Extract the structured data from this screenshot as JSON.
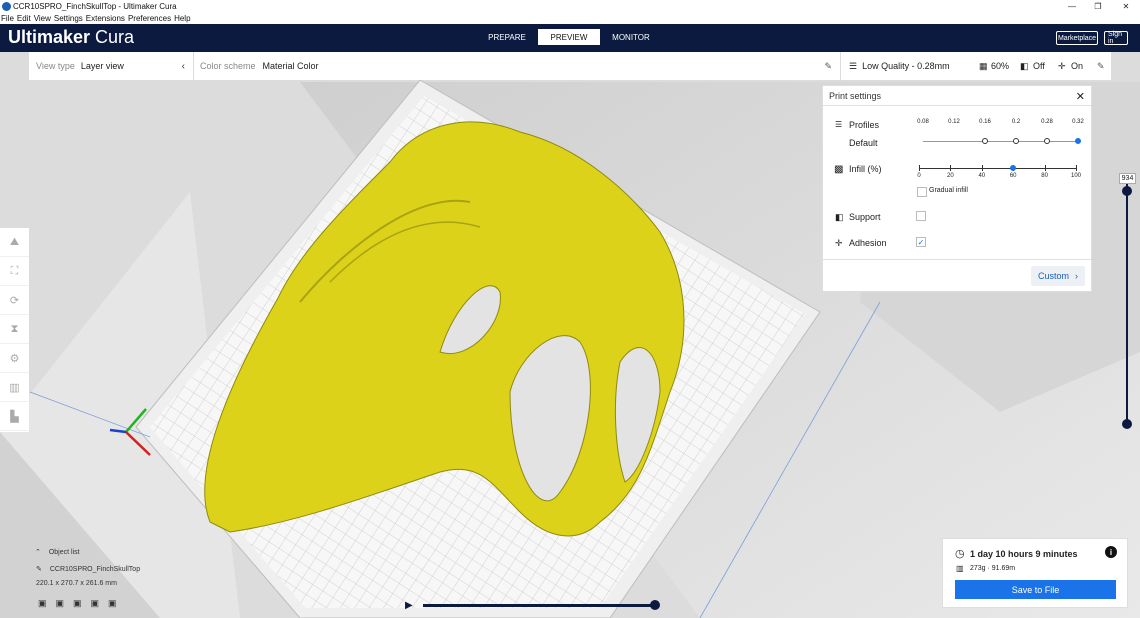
{
  "window": {
    "title": "CCR10SPRO_FinchSkullTop - Ultimaker Cura",
    "controls": {
      "minimize": "—",
      "restore": "❐",
      "close": "✕"
    }
  },
  "menu": [
    "File",
    "Edit",
    "View",
    "Settings",
    "Extensions",
    "Preferences",
    "Help"
  ],
  "header": {
    "brand_bold": "Ultimaker",
    "brand_light": " Cura",
    "stages": [
      {
        "label": "PREPARE",
        "active": false
      },
      {
        "label": "PREVIEW",
        "active": true
      },
      {
        "label": "MONITOR",
        "active": false
      }
    ],
    "marketplace": "Marketplace",
    "signin": "Sign in"
  },
  "view_panel": {
    "label": "View type",
    "value": "Layer view"
  },
  "color_panel": {
    "label": "Color scheme",
    "value": "Material Color"
  },
  "quick_settings": {
    "profile": "Low Quality - 0.28mm",
    "infill": "60%",
    "support": "Off",
    "adhesion": "On"
  },
  "print_settings": {
    "title": "Print settings",
    "profiles_label": "Profiles",
    "profile_default": "Default",
    "profile_ticks": [
      "0.08",
      "0.12",
      "0.16",
      "0.2",
      "0.28",
      "0.32"
    ],
    "profile_selected": 4,
    "infill_label": "Infill (%)",
    "infill_ticks": [
      "0",
      "20",
      "40",
      "60",
      "80",
      "100"
    ],
    "infill_value": 60,
    "gradual_infill": "Gradual infill",
    "support_label": "Support",
    "support_checked": false,
    "adhesion_label": "Adhesion",
    "adhesion_checked": true,
    "custom_button": "Custom"
  },
  "layer_slider": {
    "value": "934"
  },
  "object_list": {
    "label": "Object list",
    "object_name": "CCR10SPRO_FinchSkullTop",
    "dimensions": "220.1 x 270.7 x 261.6 mm"
  },
  "print_info": {
    "time": "1 day 10 hours 9 minutes",
    "material": "273g · 91.69m",
    "save_button": "Save to File"
  },
  "colors": {
    "header_bg": "#0b1a3e",
    "accent": "#1a73e8",
    "model": "#dcd21a"
  }
}
